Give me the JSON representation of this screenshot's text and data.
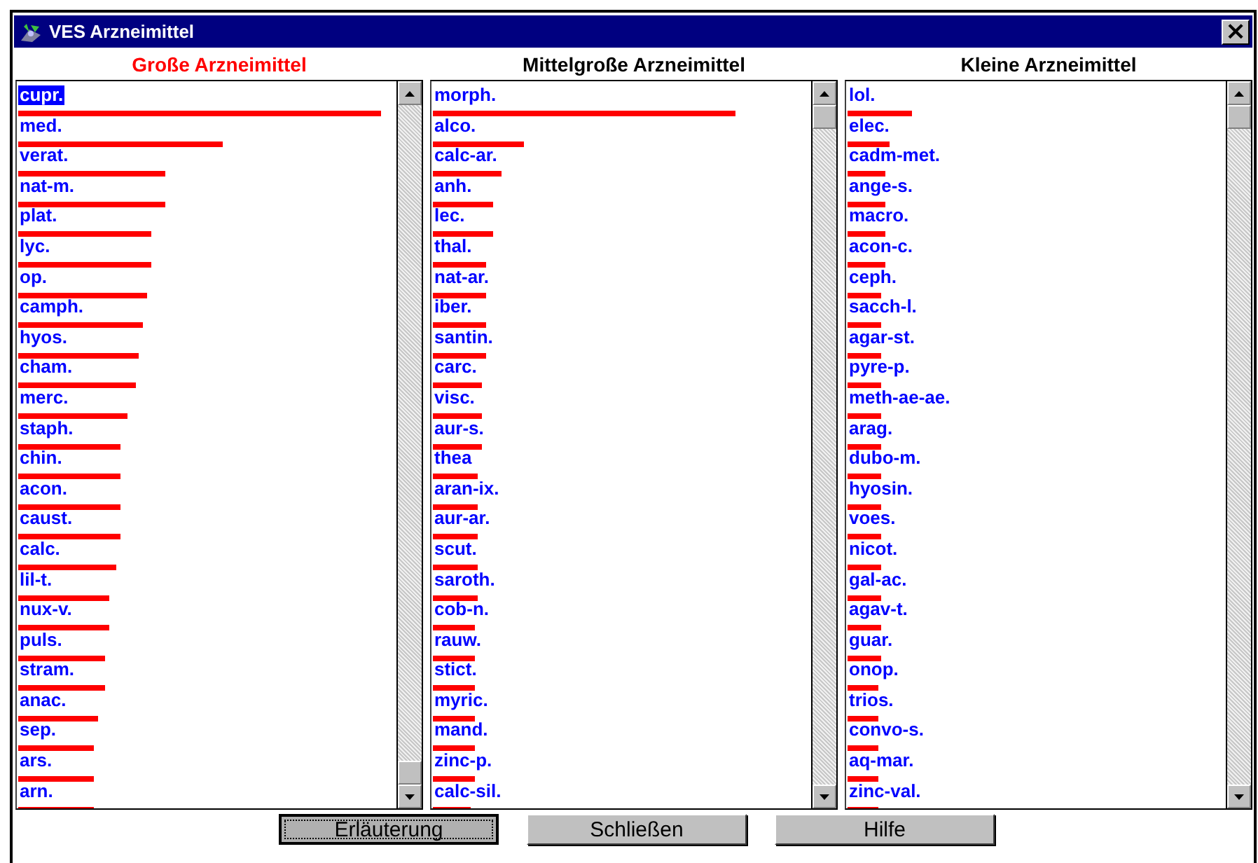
{
  "window": {
    "title": "VES Arzneimittel",
    "close": "×"
  },
  "columns": [
    {
      "title": "Große Arzneimittel",
      "color": "#ff0000",
      "items": [
        {
          "name": "cupr.",
          "selected": true
        },
        {
          "name": "med.",
          "selected": false
        },
        {
          "name": "verat.",
          "selected": false
        },
        {
          "name": "nat-m.",
          "selected": false
        },
        {
          "name": "plat.",
          "selected": false
        },
        {
          "name": "lyc.",
          "selected": false
        },
        {
          "name": "op.",
          "selected": false
        },
        {
          "name": "camph.",
          "selected": false
        },
        {
          "name": "hyos.",
          "selected": false
        },
        {
          "name": "cham.",
          "selected": false
        },
        {
          "name": "merc.",
          "selected": false
        },
        {
          "name": "staph.",
          "selected": false
        },
        {
          "name": "chin.",
          "selected": false
        },
        {
          "name": "acon.",
          "selected": false
        },
        {
          "name": "caust.",
          "selected": false
        },
        {
          "name": "calc.",
          "selected": false
        },
        {
          "name": "lil-t.",
          "selected": false
        },
        {
          "name": "nux-v.",
          "selected": false
        },
        {
          "name": "puls.",
          "selected": false
        },
        {
          "name": "stram.",
          "selected": false
        },
        {
          "name": "anac.",
          "selected": false
        },
        {
          "name": "sep.",
          "selected": false
        },
        {
          "name": "ars.",
          "selected": false
        },
        {
          "name": "arn.",
          "selected": false
        }
      ]
    },
    {
      "title": "Mittelgroße Arzneimittel",
      "color": "#000000",
      "items": [
        {
          "name": "morph.",
          "selected": false
        },
        {
          "name": "alco.",
          "selected": false
        },
        {
          "name": "calc-ar.",
          "selected": false
        },
        {
          "name": "anh.",
          "selected": false
        },
        {
          "name": "lec.",
          "selected": false
        },
        {
          "name": "thal.",
          "selected": false
        },
        {
          "name": "nat-ar.",
          "selected": false
        },
        {
          "name": "iber.",
          "selected": false
        },
        {
          "name": "santin.",
          "selected": false
        },
        {
          "name": "carc.",
          "selected": false
        },
        {
          "name": "visc.",
          "selected": false
        },
        {
          "name": "aur-s.",
          "selected": false
        },
        {
          "name": "thea",
          "selected": false
        },
        {
          "name": "aran-ix.",
          "selected": false
        },
        {
          "name": "aur-ar.",
          "selected": false
        },
        {
          "name": "scut.",
          "selected": false
        },
        {
          "name": "saroth.",
          "selected": false
        },
        {
          "name": "cob-n.",
          "selected": false
        },
        {
          "name": "rauw.",
          "selected": false
        },
        {
          "name": "stict.",
          "selected": false
        },
        {
          "name": "myric.",
          "selected": false
        },
        {
          "name": "mand.",
          "selected": false
        },
        {
          "name": "zinc-p.",
          "selected": false
        },
        {
          "name": "calc-sil.",
          "selected": false
        }
      ]
    },
    {
      "title": "Kleine Arzneimittel",
      "color": "#000000",
      "items": [
        {
          "name": "lol.",
          "selected": false
        },
        {
          "name": "elec.",
          "selected": false
        },
        {
          "name": "cadm-met.",
          "selected": false
        },
        {
          "name": "ange-s.",
          "selected": false
        },
        {
          "name": "macro.",
          "selected": false
        },
        {
          "name": "acon-c.",
          "selected": false
        },
        {
          "name": "ceph.",
          "selected": false
        },
        {
          "name": "sacch-l.",
          "selected": false
        },
        {
          "name": "agar-st.",
          "selected": false
        },
        {
          "name": "pyre-p.",
          "selected": false
        },
        {
          "name": "meth-ae-ae.",
          "selected": false
        },
        {
          "name": "arag.",
          "selected": false
        },
        {
          "name": "dubo-m.",
          "selected": false
        },
        {
          "name": "hyosin.",
          "selected": false
        },
        {
          "name": "voes.",
          "selected": false
        },
        {
          "name": "nicot.",
          "selected": false
        },
        {
          "name": "gal-ac.",
          "selected": false
        },
        {
          "name": "agav-t.",
          "selected": false
        },
        {
          "name": "guar.",
          "selected": false
        },
        {
          "name": "onop.",
          "selected": false
        },
        {
          "name": "trios.",
          "selected": false
        },
        {
          "name": "convo-s.",
          "selected": false
        },
        {
          "name": "aq-mar.",
          "selected": false
        },
        {
          "name": "zinc-val.",
          "selected": false
        }
      ]
    }
  ],
  "buttons": [
    {
      "label": "Erläuterung",
      "focused": true
    },
    {
      "label": "Schließen",
      "focused": false
    },
    {
      "label": "Hilfe",
      "focused": false
    }
  ]
}
